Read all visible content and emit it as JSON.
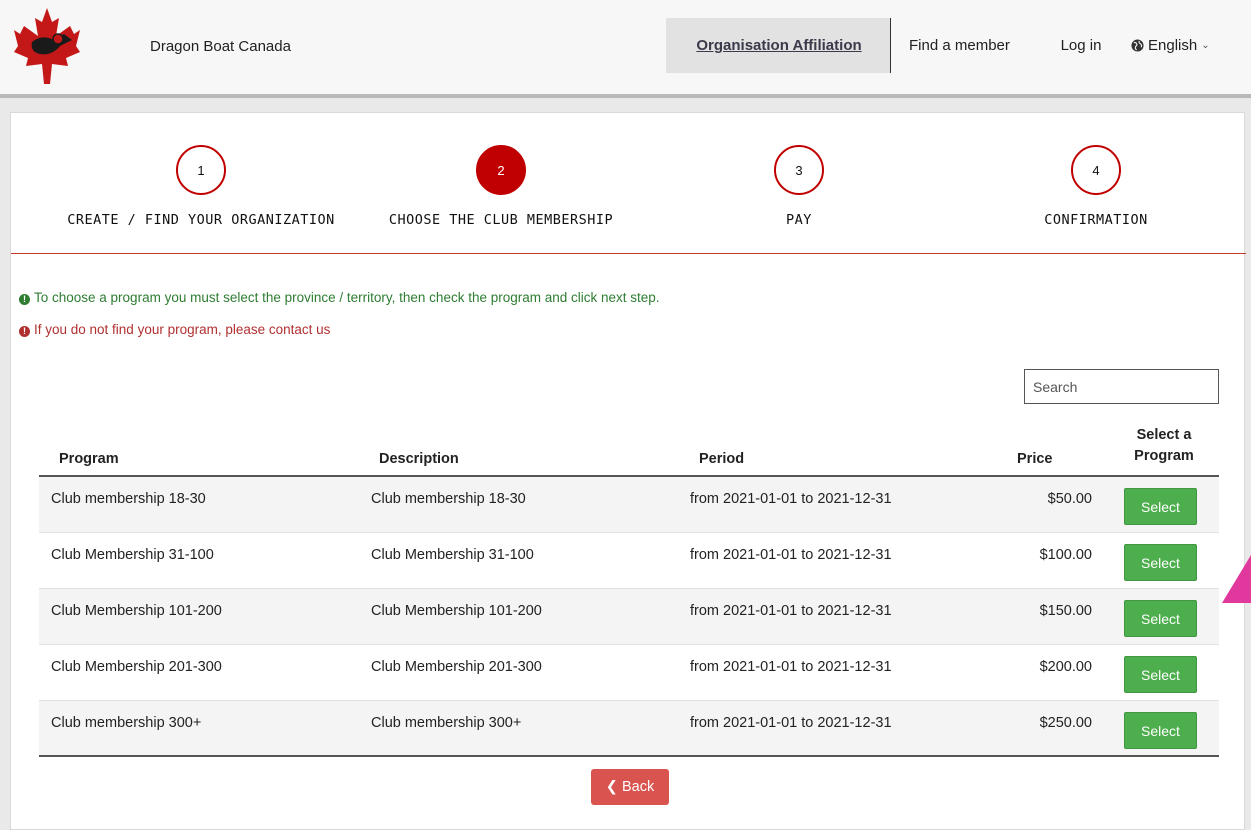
{
  "header": {
    "brand": "Dragon Boat Canada",
    "nav": {
      "affiliation": "Organisation Affiliation",
      "find_member": "Find a member",
      "login": "Log in",
      "language": "English"
    }
  },
  "steps": [
    {
      "number": "1",
      "label": "CREATE / FIND YOUR ORGANIZATION"
    },
    {
      "number": "2",
      "label": "CHOOSE THE CLUB MEMBERSHIP"
    },
    {
      "number": "3",
      "label": "PAY"
    },
    {
      "number": "4",
      "label": "CONFIRMATION"
    }
  ],
  "info": {
    "instruction": "To choose a program you must select the province / territory, then check the program and click next step.",
    "contact": "If you do not find your program, please contact us"
  },
  "search": {
    "placeholder": "Search"
  },
  "table": {
    "headers": {
      "program": "Program",
      "description": "Description",
      "period": "Period",
      "price": "Price",
      "select": "Select a Program"
    },
    "rows": [
      {
        "program": "Club membership 18-30",
        "description": "Club membership 18-30",
        "period": "from 2021-01-01 to 2021-12-31",
        "price": "$50.00",
        "action": "Select"
      },
      {
        "program": "Club Membership 31-100",
        "description": "Club Membership 31-100",
        "period": "from 2021-01-01 to 2021-12-31",
        "price": "$100.00",
        "action": "Select"
      },
      {
        "program": "Club Membership 101-200",
        "description": "Club Membership 101-200",
        "period": "from 2021-01-01 to 2021-12-31",
        "price": "$150.00",
        "action": "Select"
      },
      {
        "program": "Club Membership 201-300",
        "description": "Club Membership 201-300",
        "period": "from 2021-01-01 to 2021-12-31",
        "price": "$200.00",
        "action": "Select"
      },
      {
        "program": "Club membership 300+",
        "description": "Club membership 300+",
        "period": "from 2021-01-01 to 2021-12-31",
        "price": "$250.00",
        "action": "Select"
      }
    ]
  },
  "back_button": "Back",
  "colors": {
    "brand_red": "#c00000",
    "success_green": "#4cae4c",
    "danger_red": "#d9534f",
    "info_green": "#2e7d32",
    "info_red": "#b03030"
  }
}
